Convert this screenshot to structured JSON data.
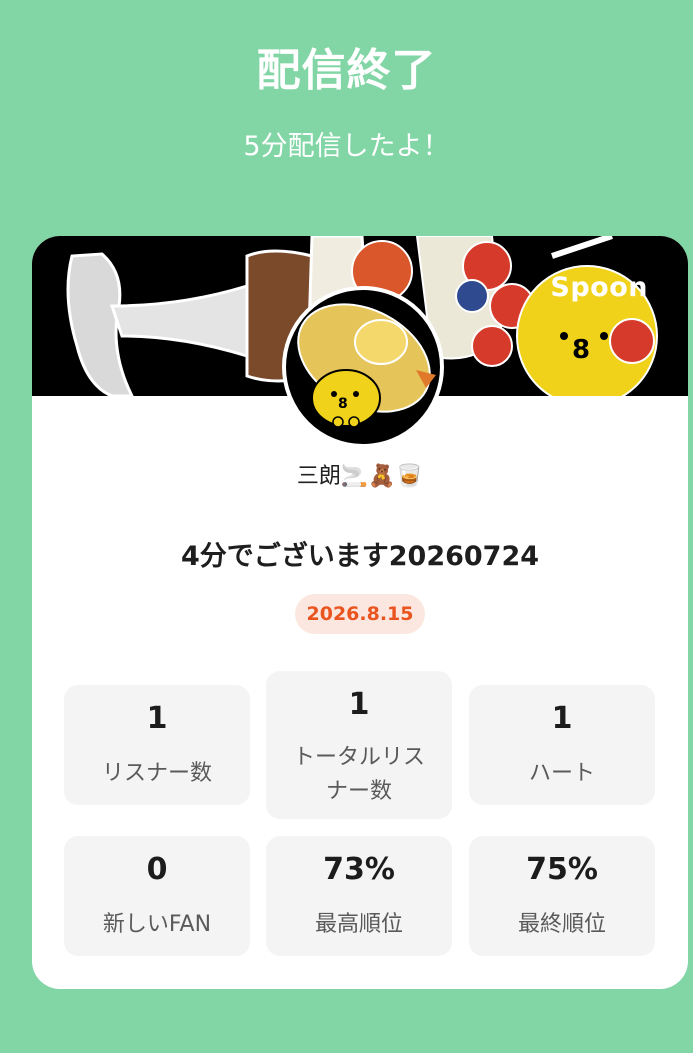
{
  "header": {
    "title": "配信終了",
    "subtitle": "5分配信したよ！"
  },
  "card": {
    "brand": "Spoon",
    "username": "三朗🚬🧸🥃",
    "stream_title": "4分でございます20260724",
    "date": "2026.8.15",
    "stats": [
      {
        "value": "1",
        "label": "リスナー数"
      },
      {
        "value": "1",
        "label": "トータルリスナー数"
      },
      {
        "value": "1",
        "label": "ハート"
      },
      {
        "value": "0",
        "label": "新しいFAN"
      },
      {
        "value": "73%",
        "label": "最高順位"
      },
      {
        "value": "75%",
        "label": "最終順位"
      }
    ]
  },
  "colors": {
    "background": "#82d6a6",
    "date_accent": "#e9541f",
    "date_badge_bg": "#fce7e0",
    "stat_bg": "#f4f4f4"
  },
  "icons": {
    "banner_art": "parfait-illustration",
    "avatar_art": "chick-with-hat-illustration"
  }
}
